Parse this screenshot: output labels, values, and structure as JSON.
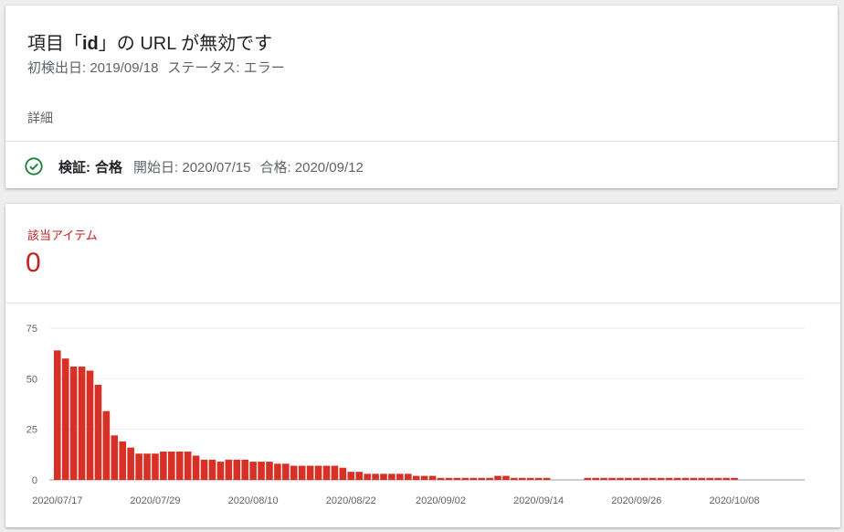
{
  "issue": {
    "title_prefix": "項目「",
    "title_id": "id",
    "title_suffix": "」の URL が無効です",
    "first_detected": "初検出日: 2019/09/18",
    "status": "ステータス: エラー",
    "details_label": "詳細",
    "validation_label": "検証:",
    "validation_status": "合格",
    "validation_started": "開始日: 2020/07/15",
    "validation_passed": "合格: 2020/09/12",
    "colors": {
      "check": "#188038"
    }
  },
  "items": {
    "label": "該当アイテム",
    "count": "0"
  },
  "chart_data": {
    "type": "bar",
    "color": "#d93025",
    "ylim": [
      0,
      75
    ],
    "yticks": [
      0,
      25,
      50,
      75
    ],
    "grid": true,
    "start_date": "2020/07/17",
    "xtick_labels": [
      "2020/07/17",
      "2020/07/29",
      "2020/08/10",
      "2020/08/22",
      "2020/09/02",
      "2020/09/14",
      "2020/09/26",
      "2020/10/08"
    ],
    "xtick_indices": [
      0,
      12,
      24,
      36,
      47,
      59,
      71,
      83
    ],
    "values": [
      64,
      60,
      56,
      56,
      54,
      47,
      34,
      22,
      19,
      16,
      13,
      13,
      13,
      14,
      14,
      14,
      14,
      12,
      10,
      10,
      9,
      10,
      10,
      10,
      9,
      9,
      9,
      8,
      8,
      7,
      7,
      7,
      7,
      7,
      7,
      6,
      4,
      4,
      3,
      3,
      3,
      3,
      3,
      3,
      2,
      2,
      2,
      1,
      1,
      1,
      1,
      1,
      1,
      1,
      2,
      2,
      1,
      1,
      1,
      1,
      1,
      0,
      0,
      0,
      0,
      1,
      1,
      1,
      1,
      1,
      1,
      1,
      1,
      1,
      1,
      1,
      1,
      1,
      1,
      1,
      1,
      1,
      1,
      1,
      0,
      0,
      0,
      0,
      0,
      0,
      0,
      0,
      0,
      0
    ]
  }
}
